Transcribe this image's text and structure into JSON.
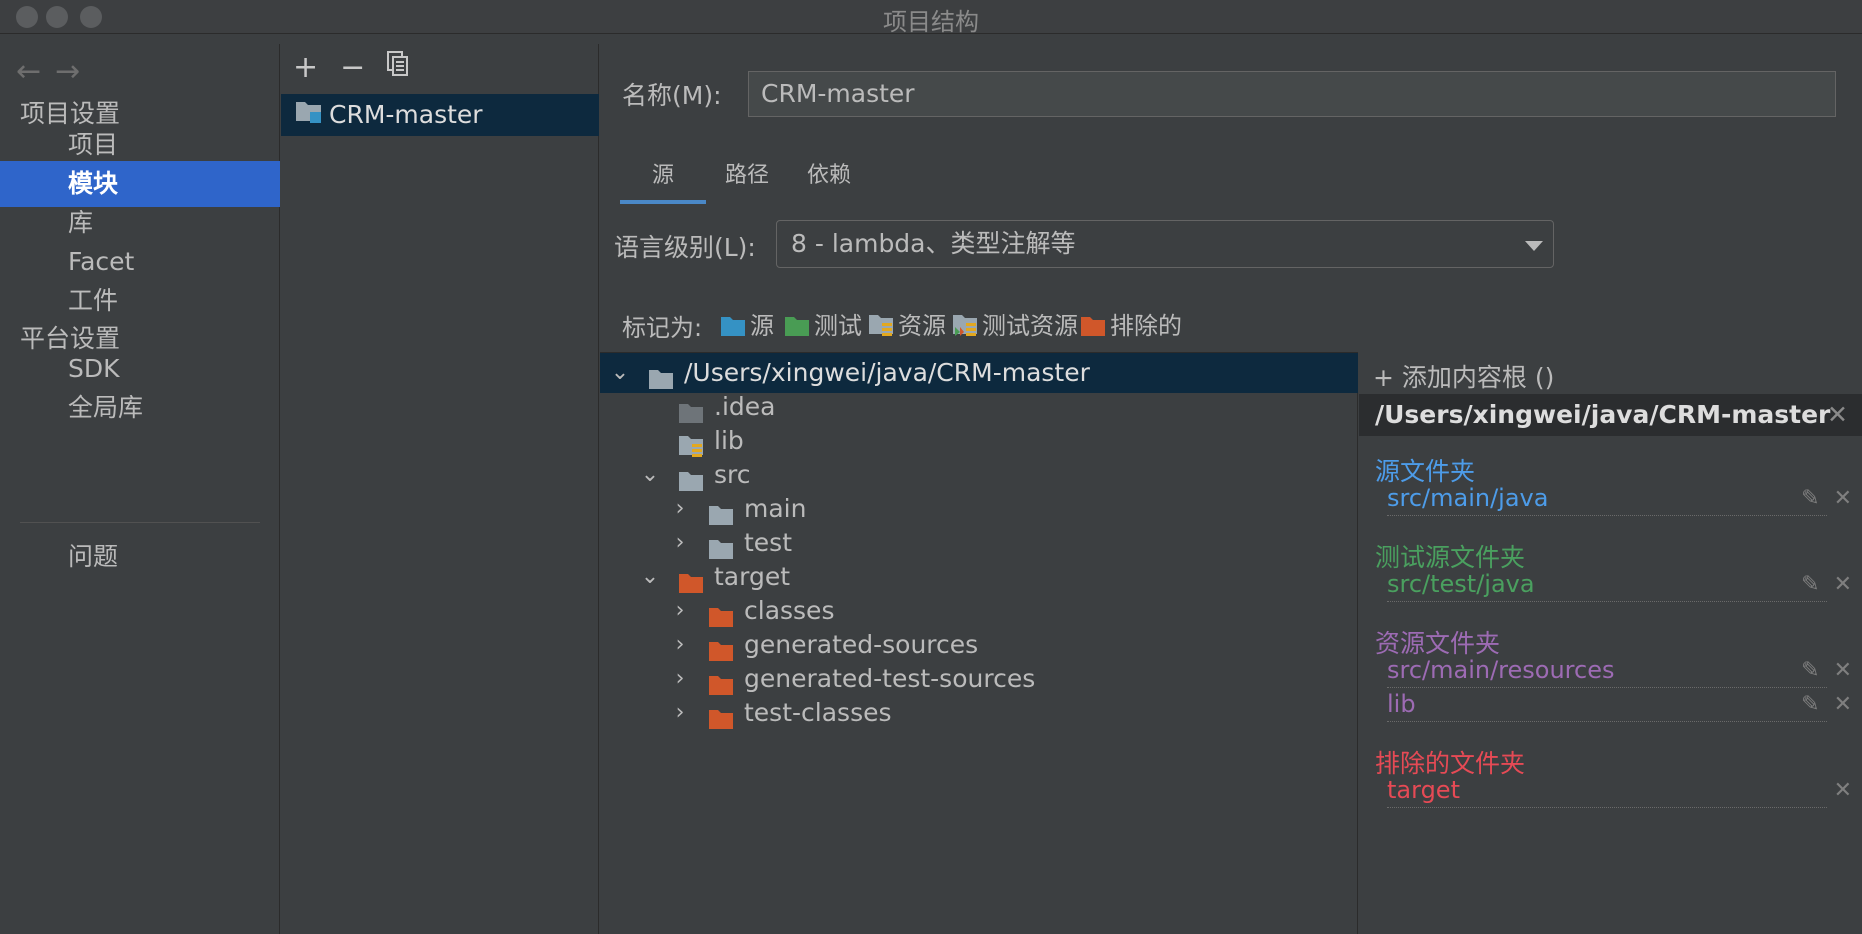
{
  "window": {
    "title": "项目结构"
  },
  "nav": {
    "back_icon": "arrow-left-icon",
    "forward_icon": "arrow-right-icon",
    "project_settings_header": "项目设置",
    "project_settings_items": [
      {
        "label": "项目"
      },
      {
        "label": "模块",
        "selected": true
      },
      {
        "label": "库"
      },
      {
        "label": "Facet"
      },
      {
        "label": "工件"
      }
    ],
    "platform_settings_header": "平台设置",
    "platform_settings_items": [
      {
        "label": "SDK"
      },
      {
        "label": "全局库"
      }
    ],
    "problems_label": "问题"
  },
  "modules": {
    "toolbar": {
      "add_icon": "plus-icon",
      "remove_icon": "minus-icon",
      "copy_icon": "copy-icon"
    },
    "items": [
      {
        "label": "CRM-master",
        "selected": true
      }
    ]
  },
  "module_detail": {
    "name_label": "名称(M):",
    "name_value": "CRM-master",
    "tabs": [
      {
        "label": "源",
        "active": true
      },
      {
        "label": "路径"
      },
      {
        "label": "依赖"
      }
    ],
    "language_level_label": "语言级别(L):",
    "language_level_value": "8 - lambda、类型注解等",
    "mark_as_label": "标记为:",
    "mark_as_options": [
      {
        "label": "源",
        "color": "#3592c4"
      },
      {
        "label": "测试",
        "color": "#499c54"
      },
      {
        "label": "资源",
        "color": "#9aa7b0"
      },
      {
        "label": "测试资源",
        "color": "#9aa7b0"
      },
      {
        "label": "排除的",
        "color": "#e0641e"
      }
    ]
  },
  "tree": {
    "rows": [
      {
        "label": "/Users/xingwei/java/CRM-master",
        "expanded": true,
        "selected": true,
        "color": "#9aa7b0"
      },
      {
        "label": ".idea",
        "color": "#6e7479"
      },
      {
        "label": "lib",
        "color": "#9aa7b0",
        "resource": true
      },
      {
        "label": "src",
        "expanded": true,
        "color": "#9aa7b0"
      },
      {
        "label": "main",
        "expanded": false,
        "color": "#9aa7b0"
      },
      {
        "label": "test",
        "expanded": false,
        "color": "#9aa7b0"
      },
      {
        "label": "target",
        "expanded": true,
        "color": "#d0572a"
      },
      {
        "label": "classes",
        "expanded": false,
        "color": "#d0572a"
      },
      {
        "label": "generated-sources",
        "expanded": false,
        "color": "#d0572a"
      },
      {
        "label": "generated-test-sources",
        "expanded": false,
        "color": "#d0572a"
      },
      {
        "label": "test-classes",
        "expanded": false,
        "color": "#d0572a"
      }
    ]
  },
  "content_roots": {
    "add_label": "添加内容根 ()",
    "root_path": "/Users/xingwei/java/CRM-master",
    "groups": [
      {
        "title": "源文件夹",
        "color": "#4d9ce9",
        "entries": [
          "src/main/java"
        ],
        "editable": true
      },
      {
        "title": "测试源文件夹",
        "color": "#4aa05f",
        "entries": [
          "src/test/java"
        ],
        "editable": true
      },
      {
        "title": "资源文件夹",
        "color": "#9d6bb4",
        "entries": [
          "src/main/resources",
          "lib"
        ],
        "editable": true
      },
      {
        "title": "排除的文件夹",
        "color": "#e64a55",
        "entries": [
          "target"
        ],
        "editable": false
      }
    ]
  }
}
